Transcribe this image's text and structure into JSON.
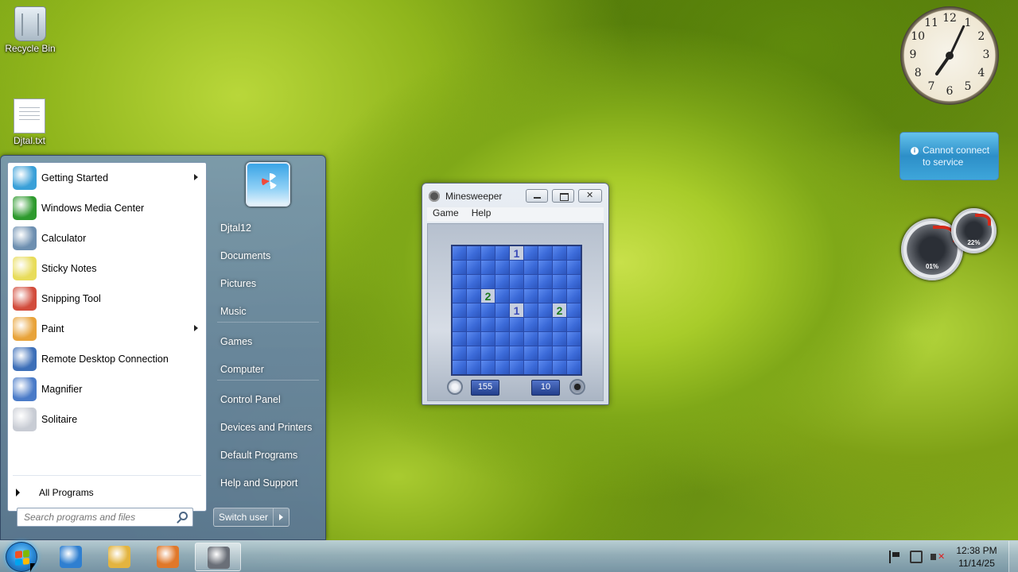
{
  "desktop": {
    "icons": [
      {
        "label": "Recycle Bin",
        "icon": "recycle-bin-icon"
      },
      {
        "label": "Djtal.txt",
        "icon": "text-file-icon"
      }
    ]
  },
  "start_menu": {
    "programs": [
      {
        "label": "Getting Started",
        "icon": "getting-started-icon",
        "submenu": true,
        "color": "#3aa0d8"
      },
      {
        "label": "Windows Media Center",
        "icon": "windows-media-center-icon",
        "submenu": false,
        "color": "#2e9a2e"
      },
      {
        "label": "Calculator",
        "icon": "calculator-icon",
        "submenu": false,
        "color": "#6d8fb0"
      },
      {
        "label": "Sticky Notes",
        "icon": "sticky-notes-icon",
        "submenu": false,
        "color": "#e8dc5a"
      },
      {
        "label": "Snipping Tool",
        "icon": "snipping-tool-icon",
        "submenu": false,
        "color": "#d24c3c"
      },
      {
        "label": "Paint",
        "icon": "paint-icon",
        "submenu": true,
        "color": "#e8a33a"
      },
      {
        "label": "Remote Desktop Connection",
        "icon": "remote-desktop-icon",
        "submenu": false,
        "color": "#3d6fb8"
      },
      {
        "label": "Magnifier",
        "icon": "magnifier-icon",
        "submenu": false,
        "color": "#4a7bc8"
      },
      {
        "label": "Solitaire",
        "icon": "solitaire-icon",
        "submenu": false,
        "color": "#c8ccd4"
      }
    ],
    "all_programs": "All Programs",
    "search_placeholder": "Search programs and files",
    "right_items": [
      "Djtal12",
      "Documents",
      "Pictures",
      "Music",
      "Games",
      "Computer",
      "Control Panel",
      "Devices and Printers",
      "Default Programs",
      "Help and Support"
    ],
    "switch_user": "Switch user"
  },
  "minesweeper": {
    "title": "Minesweeper",
    "menu": [
      "Game",
      "Help"
    ],
    "grid_size": 9,
    "revealed": [
      {
        "row": 1,
        "col": 5,
        "value": "1"
      },
      {
        "row": 4,
        "col": 3,
        "value": "2"
      },
      {
        "row": 5,
        "col": 5,
        "value": "1"
      },
      {
        "row": 5,
        "col": 8,
        "value": "2"
      }
    ],
    "time": "155",
    "mines": "10"
  },
  "gadgets": {
    "clock_numbers": [
      "12",
      "1",
      "2",
      "3",
      "4",
      "5",
      "6",
      "7",
      "8",
      "9",
      "10",
      "11"
    ],
    "service_message": "Cannot connect to service",
    "cpu_percent": "01%",
    "memory_percent": "22%"
  },
  "taskbar": {
    "apps": [
      {
        "name": "internet-explorer",
        "color": "#2f7fd0"
      },
      {
        "name": "windows-explorer",
        "color": "#e3b440"
      },
      {
        "name": "media-player",
        "color": "#e0782a"
      },
      {
        "name": "minesweeper",
        "color": "#6a6f78",
        "active": true
      }
    ],
    "time": "12:38 PM",
    "date": "11/14/25"
  }
}
